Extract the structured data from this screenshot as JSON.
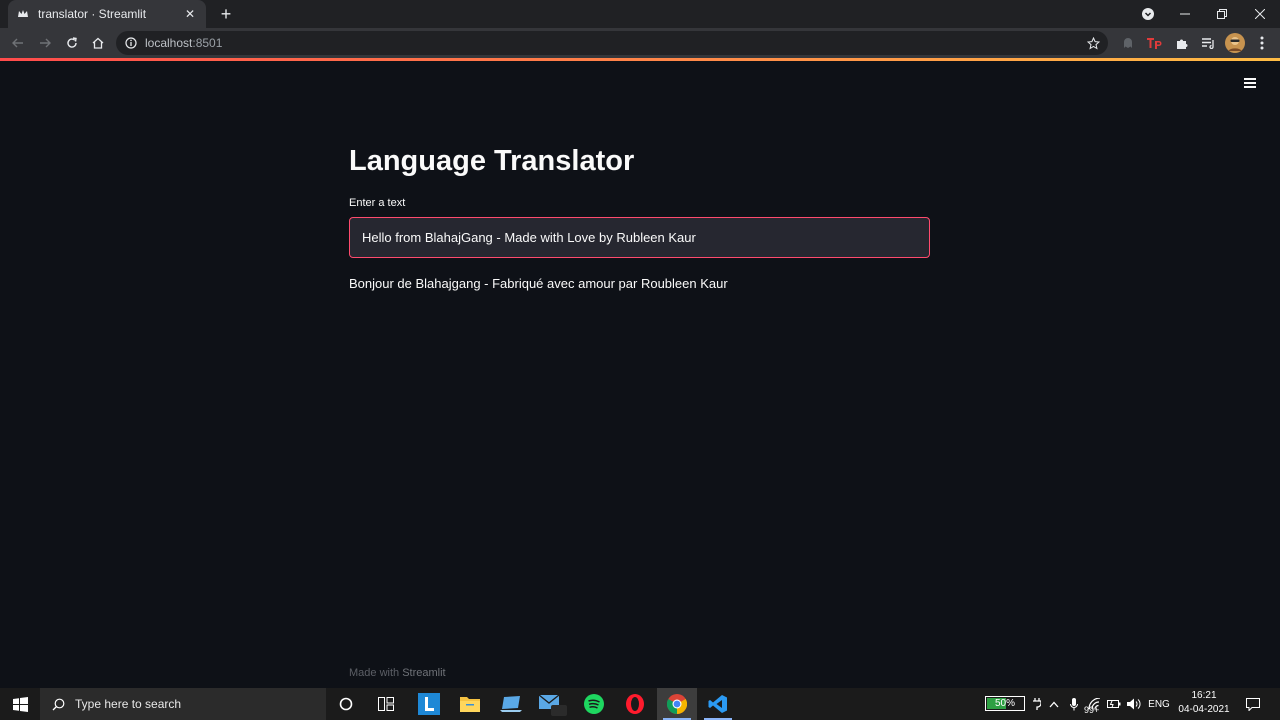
{
  "browser": {
    "tab_title": "translator · Streamlit",
    "close_glyph": "✕",
    "new_tab_glyph": "+",
    "url_host": "localhost",
    "url_port": ":8501"
  },
  "app": {
    "title": "Language Translator",
    "input_label": "Enter a text",
    "input_value": "Hello from BlahajGang - Made with Love by Rubleen Kaur",
    "output_text": "Bonjour de Blahajgang - Fabriqué avec amour par Roubleen Kaur",
    "footer_prefix": "Made with ",
    "footer_brand": "Streamlit",
    "accent_color": "#ff4b4b",
    "input_border_color": "#ff4b6e",
    "background_color": "#0e1117"
  },
  "taskbar": {
    "search_placeholder": "Type here to search",
    "mail_badge": "99+",
    "battery_text": "50%",
    "battery_level": 0.5,
    "language": "ENG",
    "time": "16:21",
    "date": "04-04-2021"
  }
}
